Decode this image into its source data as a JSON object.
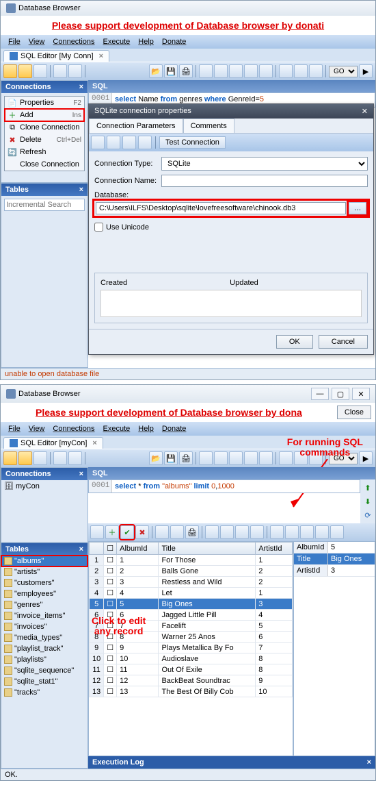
{
  "win1": {
    "title": "Database Browser",
    "banner": "Please support development of Database browser by donati",
    "menus": [
      "File",
      "View",
      "Connections",
      "Execute",
      "Help",
      "Donate"
    ],
    "tab": "SQL Editor [My Conn]",
    "go": "GO",
    "panels": {
      "connections": "Connections",
      "sql": "SQL",
      "tables": "Tables"
    },
    "context": {
      "properties": "Properties",
      "properties_key": "F2",
      "add": "Add",
      "add_key": "Ins",
      "clone": "Clone Connection",
      "delete": "Delete",
      "delete_key": "Ctrl+Del",
      "refresh": "Refresh",
      "close": "Close Connection"
    },
    "search_placeholder": "Incremental Search",
    "sql_line": "0001",
    "sql": {
      "k1": "select",
      "c1": " Name ",
      "k2": "from",
      "c2": " genres ",
      "k3": "where",
      "c3": " GenreId=",
      "n": "5"
    },
    "dialog": {
      "title": "SQLite connection properties",
      "tabs": [
        "Connection Parameters",
        "Comments"
      ],
      "test": "Test Connection",
      "conn_type": "Connection Type:",
      "conn_type_val": "SQLite",
      "conn_name": "Connection Name:",
      "database": "Database:",
      "db_path": "C:\\Users\\ILFS\\Desktop\\sqlite\\lovefreesoftware\\chinook.db3",
      "unicode": "Use Unicode",
      "created": "Created",
      "updated": "Updated",
      "ok": "OK",
      "cancel": "Cancel"
    },
    "status": "unable to open database file"
  },
  "win2": {
    "title": "Database Browser",
    "banner": "Please support development of Database browser by dona",
    "close": "Close",
    "menus": [
      "File",
      "View",
      "Connections",
      "Execute",
      "Help",
      "Donate"
    ],
    "tab": "SQL Editor [myCon]",
    "go": "GO",
    "anno1": "For running SQL\ncommands",
    "anno2": "Click to edit\nany record",
    "panels": {
      "connections": "Connections",
      "sql": "SQL",
      "tables": "Tables",
      "exec": "Execution Log"
    },
    "conn_item": "myCon",
    "tables": [
      "\"albums\"",
      "\"artists\"",
      "\"customers\"",
      "\"employees\"",
      "\"genres\"",
      "\"invoice_items\"",
      "\"invoices\"",
      "\"media_types\"",
      "\"playlist_track\"",
      "\"playlists\"",
      "\"sqlite_sequence\"",
      "\"sqlite_stat1\"",
      "\"tracks\""
    ],
    "sql_line": "0001",
    "sql": {
      "k1": "select",
      "c1": " * ",
      "k2": "from",
      "c2": " ",
      "s1": "\"albums\"",
      "c3": " ",
      "k3": "limit",
      "c4": " ",
      "n1": "0",
      "c5": ",",
      "n2": "1000"
    },
    "grid_cols": [
      "AlbumId",
      "Title",
      "ArtistId"
    ],
    "grid_rows": [
      [
        "1",
        "For Those",
        "1"
      ],
      [
        "2",
        "Balls Gone",
        "2"
      ],
      [
        "3",
        "Restless and Wild",
        "2"
      ],
      [
        "4",
        "Let",
        "1"
      ],
      [
        "5",
        "Big Ones",
        "3"
      ],
      [
        "6",
        "Jagged Little Pill",
        "4"
      ],
      [
        "7",
        "Facelift",
        "5"
      ],
      [
        "8",
        "Warner 25 Anos",
        "6"
      ],
      [
        "9",
        "Plays Metallica By Fo",
        "7"
      ],
      [
        "10",
        "Audioslave",
        "8"
      ],
      [
        "11",
        "Out Of Exile",
        "8"
      ],
      [
        "12",
        "BackBeat Soundtrac",
        "9"
      ],
      [
        "13",
        "The Best Of Billy Cob",
        "10"
      ]
    ],
    "selected_row": 4,
    "detail": [
      [
        "AlbumId",
        "5"
      ],
      [
        "Title",
        "Big Ones"
      ],
      [
        "ArtistId",
        "3"
      ]
    ],
    "status": "OK."
  }
}
